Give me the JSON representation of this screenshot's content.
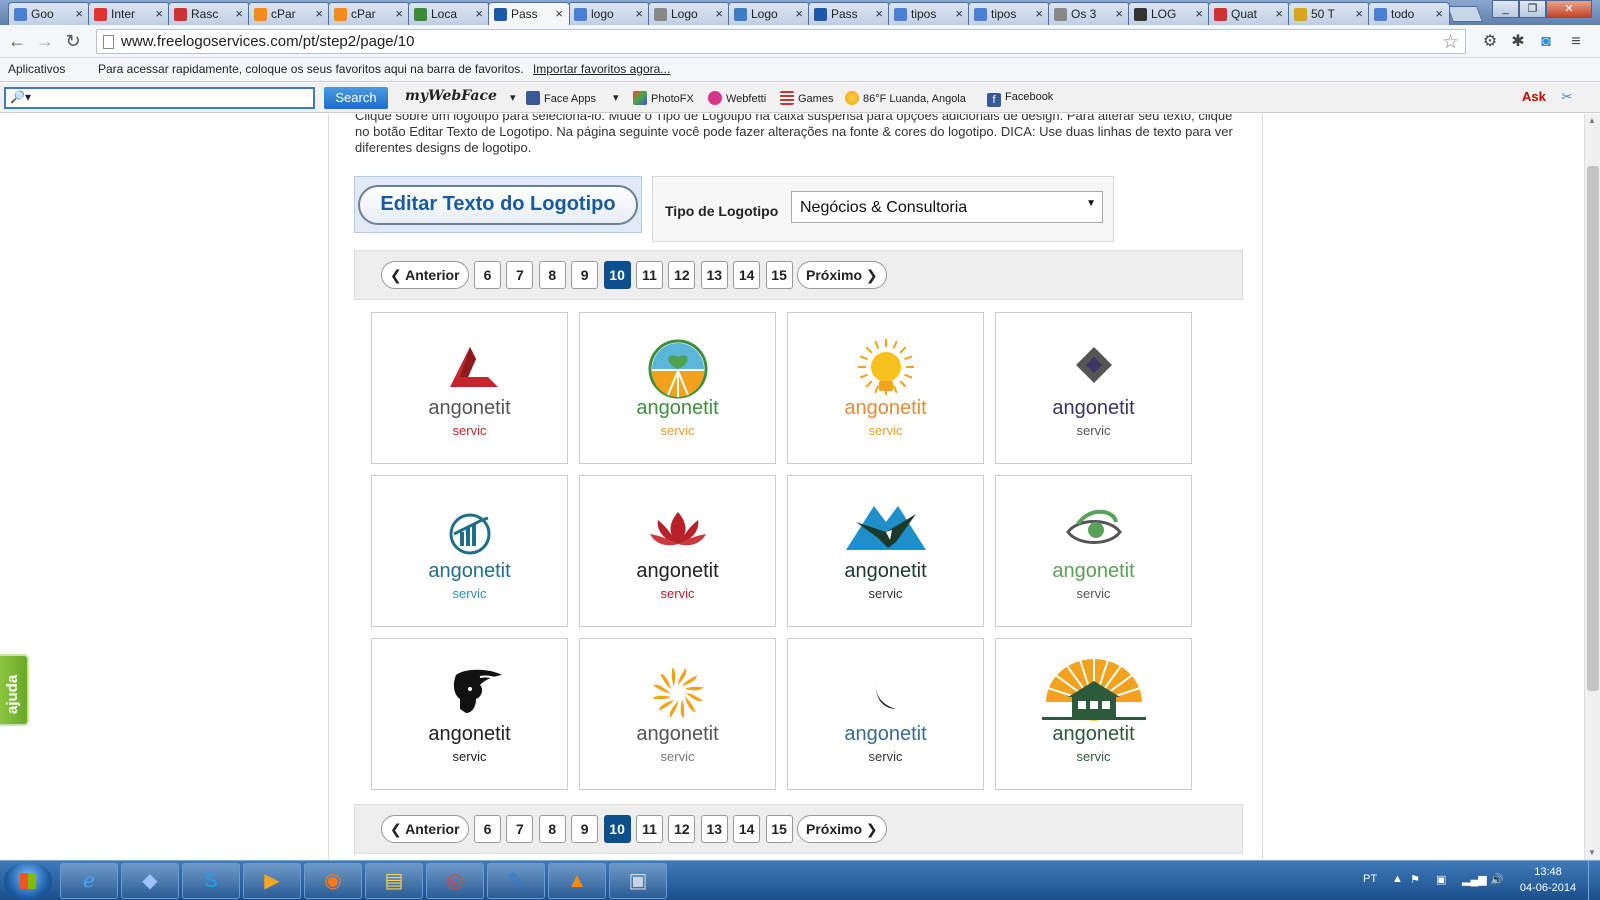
{
  "browser": {
    "tabs": [
      {
        "label": "Goo",
        "color": "#4a7fd1"
      },
      {
        "label": "Inter",
        "color": "#d33"
      },
      {
        "label": "Rasc",
        "color": "#c33"
      },
      {
        "label": "cPar",
        "color": "#f28a1c"
      },
      {
        "label": "cPar",
        "color": "#f28a1c"
      },
      {
        "label": "Loca",
        "color": "#3a8a3a"
      },
      {
        "label": "Pass",
        "color": "#1c5aa8"
      },
      {
        "label": "logo",
        "color": "#4a7fd1"
      },
      {
        "label": "Logo",
        "color": "#888"
      },
      {
        "label": "Logo",
        "color": "#3b7cc4"
      },
      {
        "label": "Pass",
        "color": "#1c5aa8"
      },
      {
        "label": "tipos",
        "color": "#4a7fd1"
      },
      {
        "label": "tipos",
        "color": "#4a7fd1"
      },
      {
        "label": "Os 3",
        "color": "#888"
      },
      {
        "label": "LOG",
        "color": "#333"
      },
      {
        "label": "Quat",
        "color": "#c33"
      },
      {
        "label": "50 T",
        "color": "#d9a521"
      },
      {
        "label": "todo",
        "color": "#4a7fd1"
      }
    ],
    "active_tab_index": 6,
    "tab_close_glyph": "×",
    "url": "www.freelogoservices.com/pt/step2/page/10",
    "bookmarks": {
      "apps_label": "Aplicativos",
      "hint": "Para acessar rapidamente, coloque os seus favoritos aqui na barra de favoritos.",
      "import_link": "Importar favoritos agora..."
    }
  },
  "addon_bar": {
    "search_placeholder": "🔎▾",
    "search_button": "Search",
    "brand": "myWebFace",
    "items": [
      "Face Apps",
      "PhotoFX",
      "Webfetti",
      "Games",
      "86°F Luanda, Angola",
      "Facebook"
    ]
  },
  "page": {
    "instructions": "Clique sobre um logotipo para selecioná-lo. Mude o Tipo de Logotipo na caixa suspensa para opções adicionais de design. Para alterar seu texto, clique no botão Editar Texto de Logotipo. Na página seguinte você pode fazer alterações na fonte & cores do logotipo. DICA: Use duas linhas de texto para ver diferentes designs de logotipo.",
    "edit_button": "Editar Texto do Logotipo",
    "logo_type_label": "Tipo de Logotipo",
    "logo_type_value": "Negócios & Consultoria",
    "pagination": {
      "prev": "Anterior",
      "next": "Próximo",
      "pages": [
        "6",
        "7",
        "8",
        "9",
        "10",
        "11",
        "12",
        "13",
        "14",
        "15"
      ],
      "current": "10"
    },
    "logos": [
      {
        "line1": "angonetit",
        "line2": "servic",
        "icon": "red-triangle-icon",
        "c1": "#555",
        "c2": "#c1272d"
      },
      {
        "line1": "angonetit",
        "line2": "servic",
        "icon": "leaf-sun-circle-icon",
        "c1": "#3f8f3f",
        "c2": "#e39a2e"
      },
      {
        "line1": "angonetit",
        "line2": "servic",
        "icon": "lightbulb-sun-icon",
        "c1": "#e38b3a",
        "c2": "#e3a11f"
      },
      {
        "line1": "angonetit",
        "line2": "servic",
        "icon": "diamond-icon",
        "c1": "#3b3566",
        "c2": "#555"
      },
      {
        "line1": "angonetit",
        "line2": "servic",
        "icon": "growth-chart-circle-icon",
        "c1": "#1f6f8b",
        "c2": "#2f8fb0"
      },
      {
        "line1": "angonetit",
        "line2": "servic",
        "icon": "lotus-icon",
        "c1": "#222",
        "c2": "#b8212a"
      },
      {
        "line1": "angonetit",
        "line2": "servic",
        "icon": "eagle-mountain-icon",
        "c1": "#1b3a2a",
        "c2": "#333"
      },
      {
        "line1": "angonetit",
        "line2": "servic",
        "icon": "eye-swirl-icon",
        "c1": "#5aa25a",
        "c2": "#555"
      },
      {
        "line1": "angonetit",
        "line2": "servic",
        "icon": "hermes-head-icon",
        "c1": "#222",
        "c2": "#222"
      },
      {
        "line1": "angonetit",
        "line2": "servic",
        "icon": "starburst-icon",
        "c1": "#555",
        "c2": "#777"
      },
      {
        "line1": "angonetit",
        "line2": "servic",
        "icon": "crescent-icon",
        "c1": "#3a6a93",
        "c2": "#333"
      },
      {
        "line1": "angonetit",
        "line2": "servic",
        "icon": "house-sunrise-icon",
        "c1": "#2c5a3a",
        "c2": "#2c5a3a"
      }
    ],
    "help_tab": "ajuda"
  },
  "taskbar": {
    "apps": [
      "Internet Explorer",
      "VirtualBox",
      "Skype",
      "Media Player",
      "Firefox",
      "Explorer",
      "Chrome",
      "Paint",
      "VLC",
      "App"
    ],
    "language": "PT",
    "time": "13:48",
    "date": "04-06-2014"
  }
}
